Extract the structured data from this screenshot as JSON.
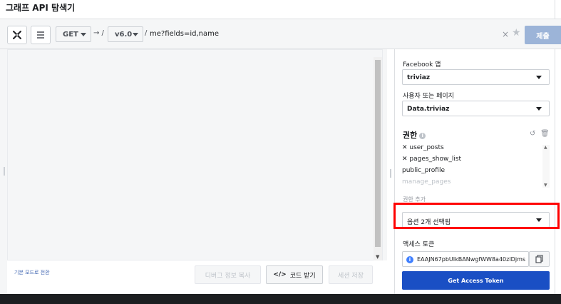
{
  "window": {
    "title": "그래프 API 탐색기"
  },
  "toolbar": {
    "method": "GET",
    "arrow": "→ /",
    "version": "v6.0",
    "slash": "/",
    "path": "me?fields=id,name",
    "clear": "×",
    "submit": "제출"
  },
  "left": {
    "mode_link": "기본 모드로 전환",
    "buttons": {
      "debug": "디버그 정보 복사",
      "code_label": "코드 받기",
      "code_icon": "</>",
      "save": "세션 저장"
    }
  },
  "right": {
    "app_label": "Facebook 앱",
    "app_value": "triviaz",
    "user_label": "사용자 또는 페이지",
    "user_value": "Data.triviaz",
    "perm_heading": "권한",
    "permissions": [
      "✕ user_posts",
      "✕ pages_show_list",
      "public_profile",
      "manage_pages"
    ],
    "add_label": "권한 추가",
    "add_value": "옵션 2개 선택됨",
    "token_label": "액세스 토큰",
    "token_value": "EAAJN67pbUIkBANwgfWW8a40zIDjms",
    "get_token": "Get Access Token"
  }
}
